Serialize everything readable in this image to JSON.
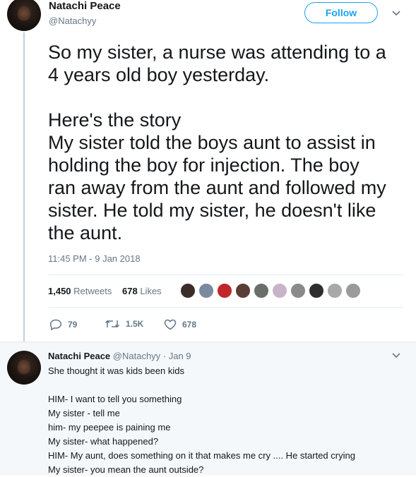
{
  "tweet": {
    "author_name": "Natachi Peace",
    "author_handle": "@Natachyy",
    "follow_label": "Follow",
    "text": "So my sister, a nurse was attending to a\n4 years old boy yesterday.\n\nHere's the story\nMy sister told the boys aunt to assist in\nholding the boy for injection. The boy\nran away from the aunt and followed my\nsister. He told my sister, he doesn't like\nthe aunt.",
    "timestamp": "11:45 PM - 9 Jan 2018",
    "retweets_count": "1,450",
    "retweets_label": "Retweets",
    "likes_count": "678",
    "likes_label": "Likes",
    "likers": [
      "#3b2e2a",
      "#7c8aa0",
      "#c0262c",
      "#5a3e36",
      "#6a6f6a",
      "#c9b3c8",
      "#8a8a8a",
      "#2d2d2d",
      "#a9a9a9",
      "#9a9a9a"
    ],
    "actions": {
      "reply_count": "79",
      "retweet_count": "1.5K",
      "like_count": "678"
    }
  },
  "reply": {
    "author_name": "Natachi Peace",
    "meta": "@Natachyy · Jan 9",
    "text": "She thought it was kids been kids\n\nHIM- I want to tell you something\nMy sister - tell me\nhim- my peepee is paining me\nMy sister- what happened?\nHIM- My aunt, does something on it that makes me cry .... He started crying\nMy sister- you mean the aunt outside?"
  }
}
